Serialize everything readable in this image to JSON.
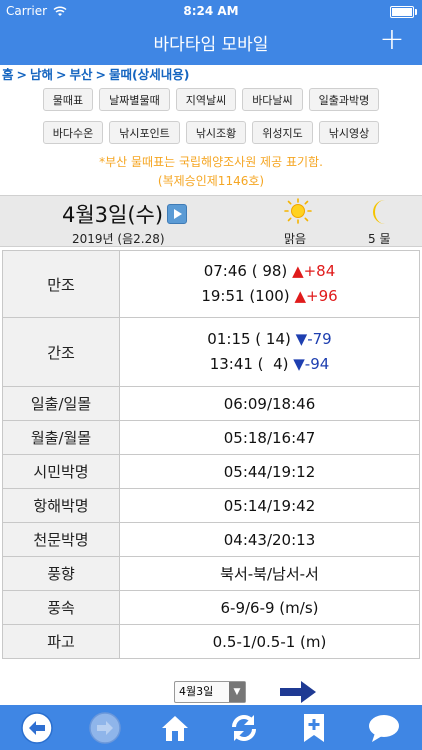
{
  "status_bar": {
    "carrier": "Carrier",
    "time": "8:24 AM"
  },
  "header": {
    "title": "바다타임 모바일",
    "plus": "+"
  },
  "breadcrumb": [
    "홈",
    "남해",
    "부산",
    "물때(상세내용)"
  ],
  "breadcrumb_sep": ">",
  "menu": {
    "row1": [
      "물때표",
      "날짜별물때",
      "지역날씨",
      "바다날씨",
      "일출과박명"
    ],
    "row2": [
      "바다수온",
      "낚시포인트",
      "낚시조황",
      "위성지도",
      "낚시영상"
    ]
  },
  "notice": {
    "line1": "*부산 물때표는 국립해양조사원 제공 표기함.",
    "line2": "(복제승인제1146호)"
  },
  "date": {
    "main": "4월3일(수)",
    "sub": "2019년 (음2.28)",
    "weather": "맑음",
    "tide_num": "5 물"
  },
  "tides": {
    "high": {
      "label": "만조",
      "rows": [
        {
          "time": "07:46 ( 98)",
          "arrow": "▲",
          "change": "+84"
        },
        {
          "time": "19:51 (100)",
          "arrow": "▲",
          "change": "+96"
        }
      ]
    },
    "low": {
      "label": "간조",
      "rows": [
        {
          "time": "01:15 ( 14)",
          "arrow": "▼",
          "change": "-79"
        },
        {
          "time": "13:41 (  4)",
          "arrow": "▼",
          "change": "-94"
        }
      ]
    }
  },
  "info_rows": [
    {
      "label": "일출/일몰",
      "value": "06:09/18:46"
    },
    {
      "label": "월출/월몰",
      "value": "05:18/16:47"
    },
    {
      "label": "시민박명",
      "value": "05:44/19:12"
    },
    {
      "label": "항해박명",
      "value": "05:14/19:42"
    },
    {
      "label": "천문박명",
      "value": "04:43/20:13"
    },
    {
      "label": "풍향",
      "value": "북서-북/남서-서"
    },
    {
      "label": "풍속",
      "value": "6-9/6-9 (m/s)"
    },
    {
      "label": "파고",
      "value": "0.5-1/0.5-1 (m)"
    }
  ],
  "date_select": {
    "value": "4월3일",
    "arrow": "▼"
  },
  "colors": {
    "header_blue": "#3f86e4",
    "up_red": "#e01b1b",
    "down_blue": "#1e3fb0",
    "notice_orange": "#f5a623",
    "nav_arrow": "#1f3a93"
  },
  "bottom_bar_icons": [
    "back-arrow-icon",
    "forward-arrow-icon",
    "home-icon",
    "refresh-icon",
    "bookmark-add-icon",
    "chat-bubble-icon"
  ]
}
